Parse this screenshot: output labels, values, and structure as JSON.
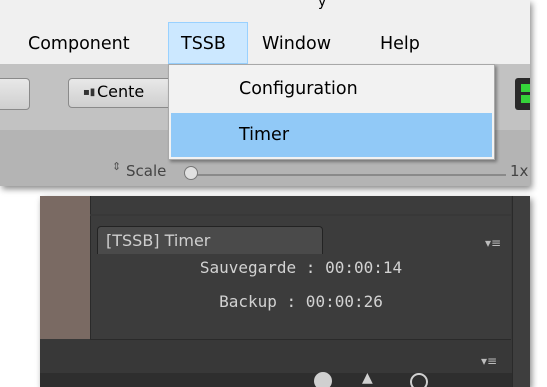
{
  "menubar": {
    "top_partial": "y",
    "items": [
      {
        "label": "Component"
      },
      {
        "label": "TSSB"
      },
      {
        "label": "Window"
      },
      {
        "label": "Help"
      }
    ]
  },
  "dropdown": {
    "items": [
      {
        "label": "Configuration"
      },
      {
        "label": "Timer"
      }
    ],
    "highlighted": "Timer"
  },
  "toolbar": {
    "center_label": "Cente",
    "scale_label": "Scale",
    "scale_value_partial": "1x"
  },
  "timer_panel": {
    "tab_title": "[TSSB] Timer",
    "sauvegarde": "Sauvegarde : 00:00:14",
    "backup": "Backup : 00:00:26"
  },
  "icons": {
    "panel_menu": "≡",
    "lower_menu": "≡"
  },
  "colors": {
    "menu_active_bg": "#cce8ff",
    "dropdown_highlight": "#91c9f7",
    "editor_dark": "#383838",
    "green_button": "#35d43a"
  }
}
